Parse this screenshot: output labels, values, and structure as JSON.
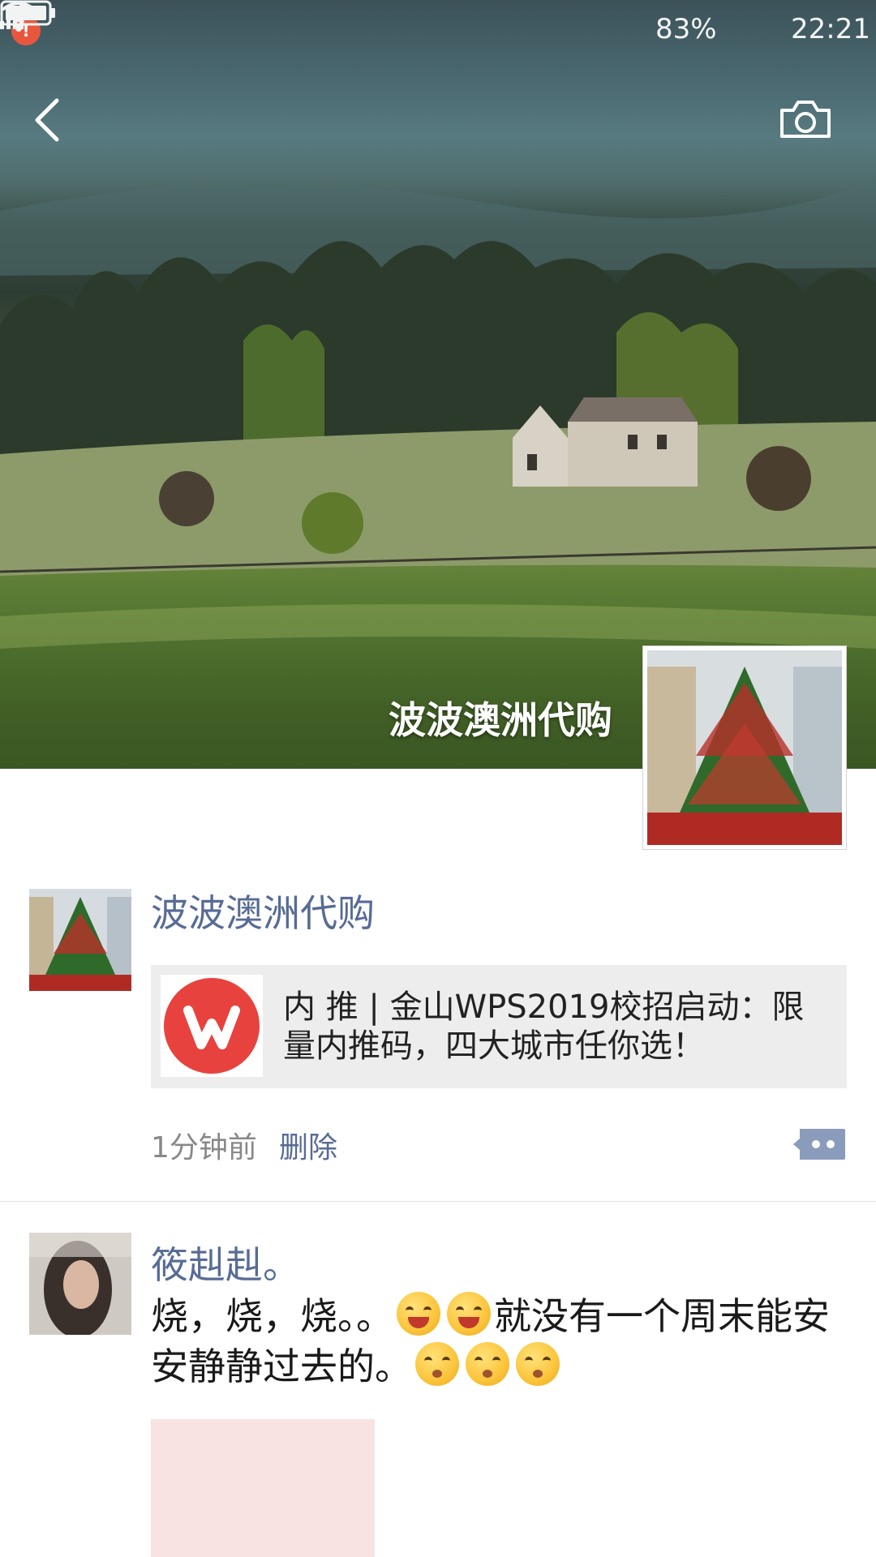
{
  "status_bar": {
    "alert_glyph": "!",
    "battery_percent": "83%",
    "time": "22:21"
  },
  "header": {
    "back_icon": "chevron-left-icon",
    "camera_icon": "camera-icon"
  },
  "profile": {
    "name": "波波澳洲代购",
    "avatar": "christmas-tree-photo"
  },
  "posts": [
    {
      "author": "波波澳洲代购",
      "link": {
        "thumb_icon": "wps-logo-icon",
        "title": "内 推 | 金山WPS2019校招启动：限量内推码，四大城市任你选！"
      },
      "time": "1分钟前",
      "delete_label": "删除",
      "comment_icon": "comment-dots-icon"
    },
    {
      "author": "筱赳赳。",
      "text_part1": "烧，烧，烧。。",
      "text_part2": "就没有一个周末能安安静静过去的。",
      "emojis_after_part1": [
        "grin-tears-emoji",
        "grin-tears-emoji"
      ],
      "emojis_after_part2": [
        "dizzy-emoji",
        "dizzy-emoji",
        "dizzy-emoji"
      ]
    }
  ]
}
